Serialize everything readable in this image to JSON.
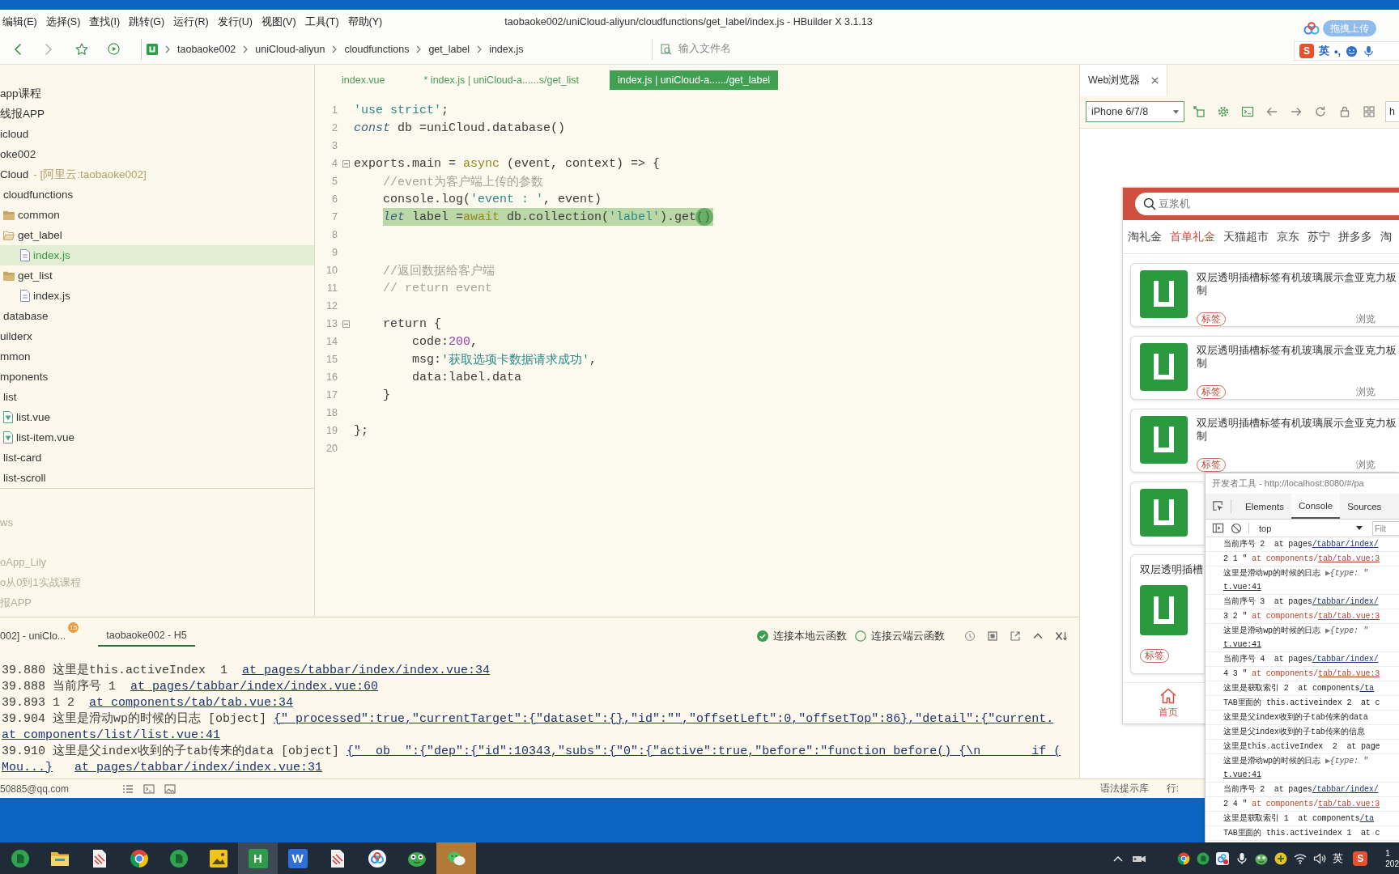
{
  "menu_bar": {
    "items": [
      "编辑(E)",
      "选择(S)",
      "查找(I)",
      "跳转(G)",
      "运行(R)",
      "发行(U)",
      "视图(V)",
      "工具(T)",
      "帮助(Y)"
    ],
    "title": "taobaoke002/uniCloud-aliyun/cloudfunctions/get_label/index.js - HBuilder X 3.1.13"
  },
  "toolbar": {
    "breadcrumb": [
      "taobaoke002",
      "uniCloud-aliyun",
      "cloudfunctions",
      "get_label",
      "index.js"
    ],
    "file_search": {
      "placeholder": "输入文件名"
    }
  },
  "desktop_overlay": {
    "upload_button": "拖拽上传",
    "ime_bar": {
      "logo": "S",
      "mode": "英",
      "punctuation": "•,"
    }
  },
  "sidebar": {
    "tree": [
      {
        "label": "app课程",
        "selected": false
      },
      {
        "label": "线报APP",
        "selected": false
      },
      {
        "label": "icloud",
        "selected": false
      },
      {
        "label": "oke002",
        "selected": false,
        "children": [
          {
            "label": "Cloud",
            "note": "- [阿里云:taobaoke002]",
            "selected": false,
            "children": [
              {
                "label": "cloudfunctions",
                "selected": false,
                "children": [
                  {
                    "label": "common",
                    "kind": "folder",
                    "selected": false
                  },
                  {
                    "label": "get_label",
                    "kind": "folder_open",
                    "selected": false,
                    "children": [
                      {
                        "label": "index.js",
                        "kind": "js_file",
                        "selected": true
                      }
                    ]
                  },
                  {
                    "label": "get_list",
                    "kind": "folder",
                    "selected": false,
                    "children": [
                      {
                        "label": "index.js",
                        "kind": "js_file",
                        "selected": false
                      }
                    ]
                  }
                ]
              },
              {
                "label": "database",
                "selected": false
              }
            ]
          },
          {
            "label": "uilderx",
            "selected": false
          },
          {
            "label": "mmon",
            "selected": false
          },
          {
            "label": "mponents",
            "selected": false,
            "children": [
              {
                "label": "list",
                "selected": false,
                "children": [
                  {
                    "label": "list.vue",
                    "kind": "vue_file",
                    "selected": false
                  },
                  {
                    "label": "list-item.vue",
                    "kind": "vue_file",
                    "selected": false
                  }
                ]
              },
              {
                "label": "list-card",
                "selected": false
              },
              {
                "label": "list-scroll",
                "selected": false
              }
            ]
          }
        ]
      }
    ],
    "other_projects": [
      "ws",
      "oApp_Lily",
      "o从0到1实战课程",
      "报APP"
    ]
  },
  "editor": {
    "tabs": [
      {
        "label": "index.vue",
        "selected": false
      },
      {
        "label": "* index.js | uniCloud-a......s/get_list",
        "selected": false
      },
      {
        "label": "index.js | uniCloud-a....../get_label",
        "selected": true
      }
    ],
    "lines": [
      {
        "n": "1",
        "fold": false,
        "selected": false,
        "tokens": [
          {
            "t": "'use strict'",
            "kind": "str"
          },
          {
            "t": ";",
            "kind": "pl"
          }
        ]
      },
      {
        "n": "2",
        "fold": false,
        "selected": false,
        "tokens": [
          {
            "t": "const",
            "kind": "kw"
          },
          {
            "t": " db =uniCloud.database()",
            "kind": "pl"
          }
        ]
      },
      {
        "n": "3",
        "fold": false,
        "selected": false
      },
      {
        "n": "4",
        "fold": true,
        "selected": false,
        "tokens": [
          {
            "t": "exports.main = ",
            "kind": "pl"
          },
          {
            "t": "async",
            "kind": "kw2"
          },
          {
            "t": " (event, context) => {",
            "kind": "pl"
          }
        ]
      },
      {
        "n": "5",
        "fold": false,
        "selected": false,
        "tokens": [
          {
            "t": "    //event为客户端上传的参数",
            "kind": "cm"
          }
        ]
      },
      {
        "n": "6",
        "fold": false,
        "selected": false,
        "tokens": [
          {
            "t": "    console.log(",
            "kind": "pl"
          },
          {
            "t": "'event : '",
            "kind": "str"
          },
          {
            "t": ", event)",
            "kind": "pl"
          }
        ]
      },
      {
        "n": "7",
        "fold": false,
        "selected": true,
        "tokens": [
          {
            "t": "    let",
            "kind": "kw"
          },
          {
            "t": " label =",
            "kind": "pl"
          },
          {
            "t": "await",
            "kind": "kw2"
          },
          {
            "t": " db.collection(",
            "kind": "pl"
          },
          {
            "t": "'label'",
            "kind": "str"
          },
          {
            "t": ").get()",
            "kind": "pl"
          }
        ]
      },
      {
        "n": "8",
        "fold": false,
        "selected": false
      },
      {
        "n": "9",
        "fold": false,
        "selected": false
      },
      {
        "n": "10",
        "fold": false,
        "selected": false,
        "tokens": [
          {
            "t": "    //返回数据给客户端",
            "kind": "cm"
          }
        ]
      },
      {
        "n": "11",
        "fold": false,
        "selected": false,
        "tokens": [
          {
            "t": "    // return event",
            "kind": "cm"
          }
        ]
      },
      {
        "n": "12",
        "fold": false,
        "selected": false
      },
      {
        "n": "13",
        "fold": true,
        "selected": false,
        "tokens": [
          {
            "t": "    return {",
            "kind": "pl"
          }
        ]
      },
      {
        "n": "14",
        "fold": false,
        "selected": false,
        "tokens": [
          {
            "t": "        code:",
            "kind": "pl"
          },
          {
            "t": "200",
            "kind": "num"
          },
          {
            "t": ",",
            "kind": "pl"
          }
        ]
      },
      {
        "n": "15",
        "fold": false,
        "selected": false,
        "tokens": [
          {
            "t": "        msg:",
            "kind": "pl"
          },
          {
            "t": "'获取选项卡数据请求成功'",
            "kind": "str"
          },
          {
            "t": ",",
            "kind": "pl"
          }
        ]
      },
      {
        "n": "16",
        "fold": false,
        "selected": false,
        "tokens": [
          {
            "t": "        data:label.data",
            "kind": "pl"
          }
        ]
      },
      {
        "n": "17",
        "fold": false,
        "selected": false,
        "tokens": [
          {
            "t": "    }",
            "kind": "pl"
          }
        ]
      },
      {
        "n": "18",
        "fold": false,
        "selected": false
      },
      {
        "n": "19",
        "fold": false,
        "selected": false,
        "tokens": [
          {
            "t": "};",
            "kind": "pl"
          }
        ]
      },
      {
        "n": "20",
        "fold": false,
        "selected": false
      }
    ]
  },
  "console": {
    "tabs": [
      {
        "label": "002] - uniClo...",
        "badge": "15",
        "selected": false
      },
      {
        "label": "taobaoke002 - H5",
        "selected": true
      }
    ],
    "options": [
      {
        "label": "连接本地云函数",
        "selected": true
      },
      {
        "label": "连接云端云函数",
        "selected": false
      }
    ],
    "lines": [
      {
        "tokens": [
          {
            "t": "39.880 这里是this.activeIndex  1  ",
            "kind": "pl"
          },
          {
            "t": "at pages/tabbar/index/index.vue:34",
            "kind": "link"
          }
        ]
      },
      {
        "tokens": [
          {
            "t": "39.888 当前序号 1  ",
            "kind": "pl"
          },
          {
            "t": "at pages/tabbar/index/index.vue:60",
            "kind": "link"
          }
        ]
      },
      {
        "tokens": [
          {
            "t": "39.893 1 2  ",
            "kind": "pl"
          },
          {
            "t": "at components/tab/tab.vue:34",
            "kind": "link"
          }
        ]
      },
      {
        "tokens": [
          {
            "t": "39.904 这里是滑动wp的时候的日志 [object] ",
            "kind": "pl"
          },
          {
            "t": "{\"_processed\":true,\"currentTarget\":{\"dataset\":{},\"id\":\"\",\"offsetLeft\":0,\"offsetTop\":86},\"detail\":{\"current.",
            "kind": "link"
          }
        ]
      },
      {
        "tokens": [
          {
            "t": "at components/list/list.vue:41",
            "kind": "link"
          }
        ]
      },
      {
        "tokens": [
          {
            "t": "39.910 这里是父index收到的子tab传来的data [object] ",
            "kind": "pl"
          },
          {
            "t": "{\"__ob__\":{\"dep\":{\"id\":10343,\"subs\":{\"0\":{\"active\":true,\"before\":\"function before() {\\n       if (",
            "kind": "link"
          }
        ]
      },
      {
        "tokens": [
          {
            "t": "Mou...}",
            "kind": "link"
          },
          {
            "t": "at pages/tabbar/index/index.vue:31",
            "kind": "link"
          }
        ]
      }
    ]
  },
  "status_bar": {
    "account": "50885@qq.com",
    "hint": "语法提示库",
    "position": "行:"
  },
  "preview": {
    "tab": "Web浏览器",
    "device": "iPhone 6/7/8",
    "url": "h",
    "app": {
      "search": {
        "placeholder": "豆浆机"
      },
      "categories": [
        {
          "label": "淘礼金",
          "selected": false
        },
        {
          "label": "首单礼金",
          "selected": true
        },
        {
          "label": "天猫超市",
          "selected": false
        },
        {
          "label": "京东",
          "selected": false
        },
        {
          "label": "苏宁",
          "selected": false
        },
        {
          "label": "拼多多",
          "selected": false
        },
        {
          "label": "淘",
          "selected": false
        }
      ],
      "cards": [
        {
          "kind": "row",
          "title_lines": [
            "双层透明插槽标签有机玻璃展示盒亚克力板",
            "制"
          ],
          "tag": "标签",
          "views": "浏览"
        },
        {
          "kind": "row",
          "title_lines": [
            "双层透明插槽标签有机玻璃展示盒亚克力板",
            "制"
          ],
          "tag": "标签",
          "views": "浏览"
        },
        {
          "kind": "row",
          "title_lines": [
            "双层透明插槽标签有机玻璃展示盒亚克力板",
            "制"
          ],
          "tag": "标签",
          "views": "浏览"
        },
        {
          "kind": "row"
        },
        {
          "kind": "wide",
          "title_lines": [
            "双层透明插槽"
          ],
          "tag": "标签"
        }
      ],
      "tabbar": [
        {
          "label": "首页",
          "selected": true
        }
      ]
    }
  },
  "devtools": {
    "title": "开发者工具 - http://localhost:8080/#/pa",
    "tabs": [
      {
        "label": "Elements",
        "selected": false
      },
      {
        "label": "Console",
        "selected": true
      },
      {
        "label": "Sources",
        "selected": false
      }
    ],
    "context": "top",
    "filter": {
      "placeholder": "Filt"
    },
    "messages": [
      {
        "tokens": [
          {
            "t": "当前序号 2  at pages",
            "kind": "pl"
          },
          {
            "t": "/tabbar/index/",
            "kind": "link"
          }
        ]
      },
      {
        "tokens": [
          {
            "t": "2 1 \" ",
            "kind": "pl"
          },
          {
            "t": "at components/",
            "kind": "src"
          },
          {
            "t": "tab/tab.vue:3",
            "kind": "srclink"
          }
        ]
      },
      {
        "tokens": [
          {
            "t": "这里是滑动wp的时候的日志 ",
            "kind": "pl"
          },
          {
            "t": "▶",
            "kind": "tri"
          },
          {
            "t": "{type: \"",
            "kind": "obj"
          }
        ],
        "source": "t.vue:41"
      },
      {
        "tokens": [
          {
            "t": "当前序号 3  at pages",
            "kind": "pl"
          },
          {
            "t": "/tabbar/index/",
            "kind": "link"
          }
        ]
      },
      {
        "tokens": [
          {
            "t": "3 2 \" ",
            "kind": "pl"
          },
          {
            "t": "at components/",
            "kind": "src"
          },
          {
            "t": "tab/tab.vue:3",
            "kind": "srclink"
          }
        ]
      },
      {
        "tokens": [
          {
            "t": "这里是滑动wp的时候的日志 ",
            "kind": "pl"
          },
          {
            "t": "▶",
            "kind": "tri"
          },
          {
            "t": "{type: \"",
            "kind": "obj"
          }
        ],
        "source": "t.vue:41"
      },
      {
        "tokens": [
          {
            "t": "当前序号 4  at pages",
            "kind": "pl"
          },
          {
            "t": "/tabbar/index/",
            "kind": "link"
          }
        ]
      },
      {
        "tokens": [
          {
            "t": "4 3 \" ",
            "kind": "pl"
          },
          {
            "t": "at components/",
            "kind": "src"
          },
          {
            "t": "tab/tab.vue:3",
            "kind": "srclink"
          }
        ]
      },
      {
        "tokens": [
          {
            "t": "这里是获取索引 2  at components",
            "kind": "pl"
          },
          {
            "t": "/ta",
            "kind": "link"
          }
        ]
      },
      {
        "tokens": [
          {
            "t": "TAB里面的 this.activeindex 2  at c",
            "kind": "pl"
          }
        ]
      },
      {
        "tokens": [
          {
            "t": "这里是父index收到的子tab传来的data",
            "kind": "pl"
          }
        ]
      },
      {
        "tokens": [
          {
            "t": "这里是父index收到的子tab传来的信息",
            "kind": "pl"
          }
        ]
      },
      {
        "tokens": [
          {
            "t": "这里是this.activeIndex  2  at page",
            "kind": "pl"
          }
        ]
      },
      {
        "tokens": [
          {
            "t": "这里是滑动wp的时候的日志 ",
            "kind": "pl"
          },
          {
            "t": "▶",
            "kind": "tri"
          },
          {
            "t": "{type: \"",
            "kind": "obj"
          }
        ],
        "source": "t.vue:41"
      },
      {
        "tokens": [
          {
            "t": "当前序号 2  at pages",
            "kind": "pl"
          },
          {
            "t": "/tabbar/index/",
            "kind": "link"
          }
        ]
      },
      {
        "tokens": [
          {
            "t": "2 4 \" ",
            "kind": "pl"
          },
          {
            "t": "at components/",
            "kind": "src"
          },
          {
            "t": "tab/tab.vue:3",
            "kind": "srclink"
          }
        ]
      },
      {
        "tokens": [
          {
            "t": "这里是获取索引 1  at components",
            "kind": "pl"
          },
          {
            "t": "/ta",
            "kind": "link"
          }
        ]
      },
      {
        "tokens": [
          {
            "t": "TAB里面的 this.activeindex 1  at c",
            "kind": "pl"
          }
        ]
      }
    ]
  },
  "taskbar": {
    "apps": [
      {
        "kind": "disc",
        "active": false,
        "alert": false
      },
      {
        "kind": "folder",
        "active": false,
        "alert": false
      },
      {
        "kind": "doc",
        "active": false,
        "alert": false
      },
      {
        "kind": "browser",
        "active": false,
        "alert": false
      },
      {
        "kind": "disc",
        "active": false,
        "alert": false
      },
      {
        "kind": "photo",
        "active": false,
        "alert": false
      },
      {
        "kind": "letter",
        "glyph": "H",
        "color": "#2d9b4a",
        "active": true,
        "alert": false
      },
      {
        "kind": "letter",
        "glyph": "W",
        "color": "#2f6fd8",
        "active": false,
        "alert": false
      },
      {
        "kind": "doc",
        "active": false,
        "alert": false
      },
      {
        "kind": "cloud",
        "active": false,
        "alert": false
      },
      {
        "kind": "face",
        "active": false,
        "alert": false
      },
      {
        "kind": "chat",
        "active": false,
        "alert": true
      }
    ],
    "tray": {
      "ime": "英",
      "logo": "S",
      "time": "1",
      "date": "202"
    }
  }
}
